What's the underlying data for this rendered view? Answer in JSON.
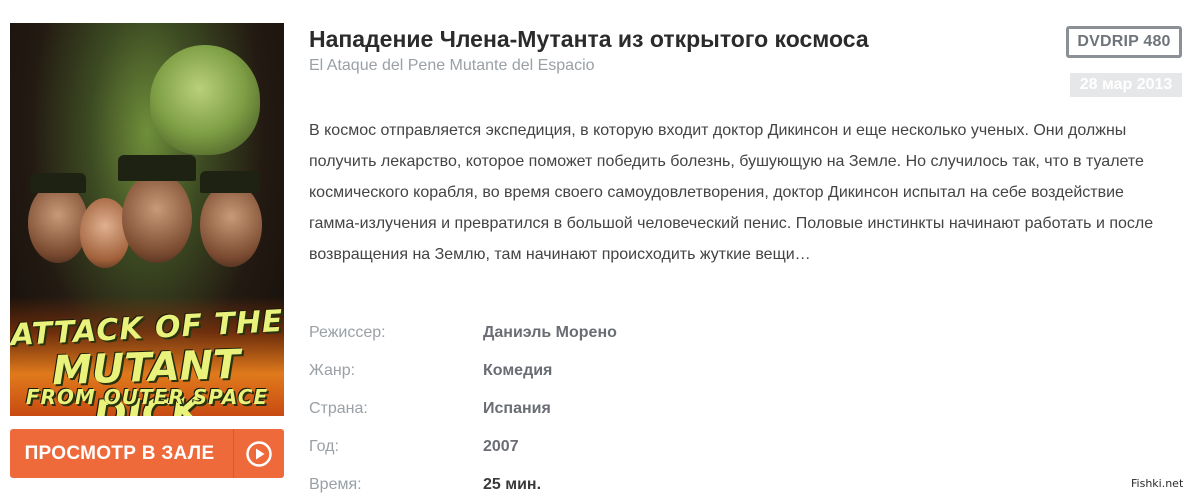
{
  "movie": {
    "title": "Нападение Члена-Мутанта из открытого космоса",
    "original_title": "El Ataque del Pene Mutante del Espacio",
    "quality_badge": "DVDRIP 480",
    "date": "28 мар 2013",
    "description": "В космос отправляется экспедиция, в которую входит доктор Дикинсон и еще несколько ученых. Они должны получить лекарство, которое поможет победить болезнь, бушующую на Земле. Но случилось так, что в туалете космического корабля, во время своего самоудовлетворения, доктор Дикинсон испытал на себе воздействие гамма-излучения и превратился в большой человеческий пенис. Половые инстинкты начинают работать и после возвращения на Землю, там начинают происходить жуткие вещи…"
  },
  "poster": {
    "title_line1": "ATTACK OF THE",
    "title_line2": "MUTANT DICK",
    "title_line3": "FROM OUTER SPACE"
  },
  "watch_button": {
    "label": "ПРОСМОТР В ЗАЛЕ",
    "icon": "play-circle-icon"
  },
  "info": [
    {
      "key": "Режиссер:",
      "value": "Даниэль Морено"
    },
    {
      "key": "Жанр:",
      "value": "Комедия"
    },
    {
      "key": "Страна:",
      "value": "Испания"
    },
    {
      "key": "Год:",
      "value": "2007"
    },
    {
      "key": "Время:",
      "value": "25 мин."
    }
  ],
  "watermark": "Fishki.net",
  "colors": {
    "accent": "#ef6a3a",
    "badge_border": "#8b8f96",
    "date_bg": "#e6e7e9"
  }
}
